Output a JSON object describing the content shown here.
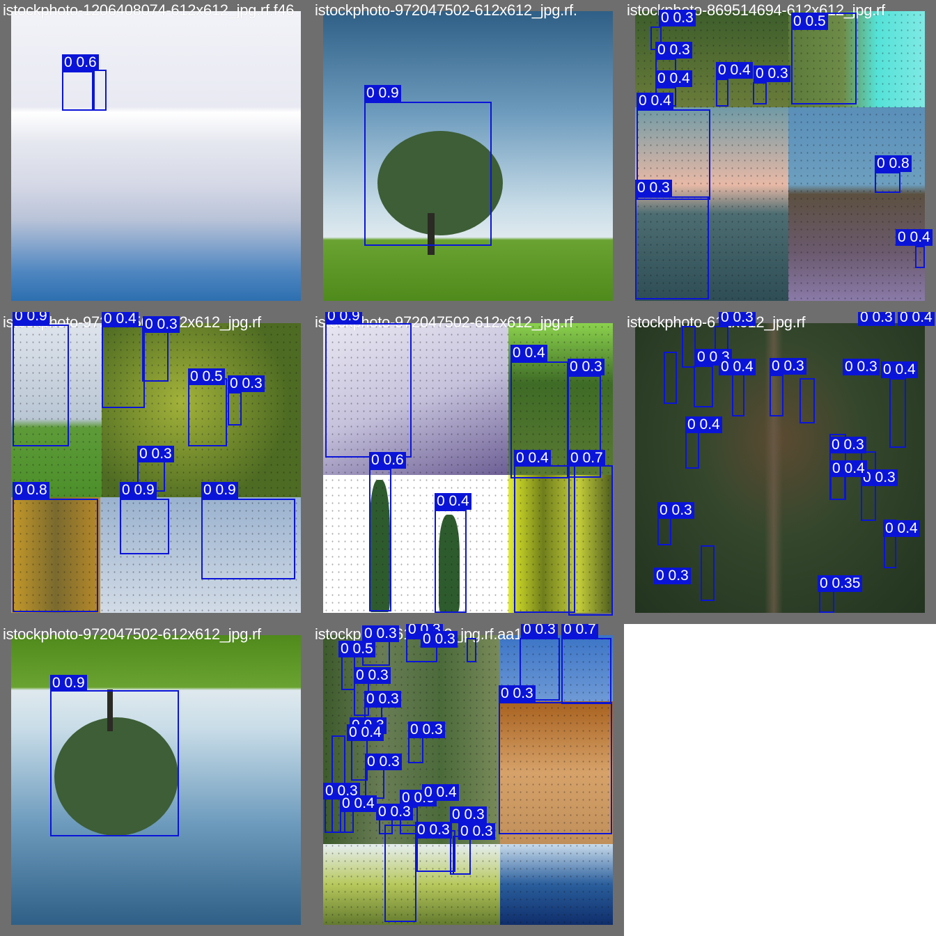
{
  "tiles": [
    {
      "filename": "istockphoto-1206408074-612x612_jpg.rf.f46",
      "boxes": [
        {
          "label": "0 0.6"
        },
        {
          "label": ""
        }
      ]
    },
    {
      "filename": "istockphoto-972047502-612x612_jpg.rf.",
      "boxes": [
        {
          "label": "0 0.9"
        }
      ]
    },
    {
      "filename": "istockphoto-869514694-612x612_jpg.rf",
      "boxes": [
        {
          "label": "0 0.3"
        },
        {
          "label": "0 0.5"
        },
        {
          "label": "0 0.3"
        },
        {
          "label": "0 0.4"
        },
        {
          "label": "0 0.3"
        },
        {
          "label": "0 0.4"
        },
        {
          "label": "0 0.4"
        },
        {
          "label": "0 0.3"
        },
        {
          "label": "0 0.8"
        },
        {
          "label": "0 0.4"
        }
      ]
    },
    {
      "filename": "istockphoto-972047502-612x612_jpg.rf",
      "boxes": [
        {
          "label": "0 0.9"
        },
        {
          "label": "0 0.4"
        },
        {
          "label": "0 0.3"
        },
        {
          "label": "0 0.5"
        },
        {
          "label": "0 0.3"
        },
        {
          "label": "0 0.3"
        },
        {
          "label": "0 0.8"
        },
        {
          "label": "0 0.9"
        },
        {
          "label": "0 0.9"
        }
      ]
    },
    {
      "filename": "istockphoto-972047502-612x612_jpg.rf",
      "boxes": [
        {
          "label": "0 0.9"
        },
        {
          "label": "0 0.6"
        },
        {
          "label": "0 0.4"
        },
        {
          "label": "0 0.4"
        },
        {
          "label": "0 0.3"
        },
        {
          "label": "0 0.4"
        },
        {
          "label": "0 0.7"
        }
      ]
    },
    {
      "filename": "istockphoto-612x612_jpg.rf",
      "boxes": [
        {
          "label": "0 0.3"
        },
        {
          "label": "0 0.3"
        },
        {
          "label": "0 0.4"
        },
        {
          "label": "0 0.3"
        },
        {
          "label": "0 0.4"
        },
        {
          "label": "0 0.3"
        },
        {
          "label": "0 0.3"
        },
        {
          "label": "0 0.4"
        },
        {
          "label": "0 0.4"
        },
        {
          "label": "0 0.3"
        },
        {
          "label": "0 0.3"
        },
        {
          "label": "0 0.4"
        },
        {
          "label": "0 0.4"
        },
        {
          "label": "0 0.3"
        },
        {
          "label": "0 0.3"
        },
        {
          "label": "0 0.35"
        }
      ]
    },
    {
      "filename": "istockphoto-972047502-612x612_jpg.rf",
      "boxes": [
        {
          "label": "0 0.9"
        }
      ]
    },
    {
      "filename": "istockphoto-612x612_jpg.rf.aa1",
      "boxes": [
        {
          "label": "0 0.3"
        },
        {
          "label": "0 0.3"
        },
        {
          "label": "0 0.3"
        },
        {
          "label": "0 0.3"
        },
        {
          "label": "0 0.7"
        },
        {
          "label": "0 0.5"
        },
        {
          "label": "0 0.3"
        },
        {
          "label": "0 0.3"
        },
        {
          "label": "0 0.3"
        },
        {
          "label": "0 0.3"
        },
        {
          "label": "0 0.3"
        },
        {
          "label": "0 0.4"
        },
        {
          "label": "0 0.3"
        },
        {
          "label": "0 0.3"
        },
        {
          "label": "0 0.4"
        },
        {
          "label": "0 0.3"
        },
        {
          "label": "0 0.3"
        },
        {
          "label": "0 0.3"
        },
        {
          "label": "0 0.4"
        },
        {
          "label": "0 0.3"
        },
        {
          "label": "0 0.3"
        }
      ]
    }
  ],
  "colors": {
    "box": "#0a14d8",
    "frame": "#6e6e6e",
    "label_text": "#ffffff"
  }
}
